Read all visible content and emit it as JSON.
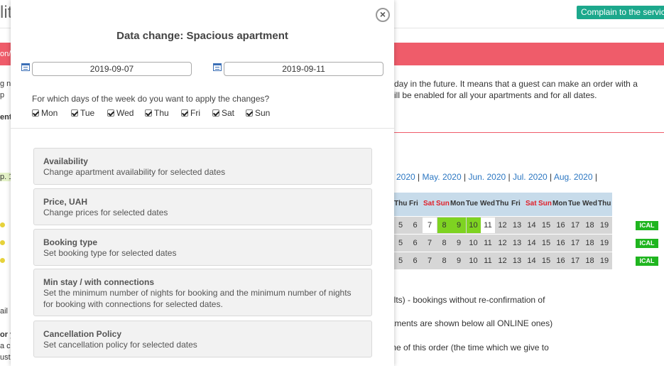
{
  "background": {
    "title_fragment": "lit",
    "complain_button": "Complain to the service",
    "alert_fragment": "on/",
    "info_line1": "day in the future. It means that a guest can make an order with a",
    "info_line2": "ill be enabled for all your apartments and for all dates.",
    "left_fragments": [
      "g n",
      "p",
      "ent",
      "p. 1",
      "ail",
      "or y",
      "a c",
      "ust"
    ],
    "months": [
      "r. 2020",
      "May. 2020",
      "Jun. 2020",
      "Jul. 2020",
      "Aug. 2020"
    ],
    "days": [
      "Thu",
      "Fri",
      "Sat",
      "Sun",
      "Mon",
      "Tue",
      "Wed",
      "Thu",
      "Fri",
      "Sat",
      "Sun",
      "Mon",
      "Tue",
      "Wed",
      "Thu"
    ],
    "row_numbers": [
      "5",
      "6",
      "7",
      "8",
      "9",
      "10",
      "11",
      "12",
      "13",
      "14",
      "15",
      "16",
      "17",
      "18",
      "19"
    ],
    "ical_label": "ICAL",
    "note1": "ults) - bookings without re-confirmation of",
    "note2": "rtments are shown below all ONLINE ones)",
    "note3": "me of this order (the time which we give to",
    "colors": {
      "accent_red": "#ef5c6a",
      "green": "#1ca88c",
      "calendar_header": "#c7dbea",
      "highlight_green": "#7ed321"
    }
  },
  "modal": {
    "title": "Data change: Spacious apartment",
    "close_icon": "close-icon",
    "date_from": "2019-09-07",
    "date_to": "2019-09-11",
    "question": "For which days of the week do you want to apply the changes?",
    "weekdays": [
      "Mon",
      "Tue",
      "Wed",
      "Thu",
      "Fri",
      "Sat",
      "Sun"
    ],
    "options": [
      {
        "title": "Availability",
        "desc": "Change apartment availability for selected dates"
      },
      {
        "title": "Price, UAH",
        "desc": "Change prices for selected dates"
      },
      {
        "title": "Booking type",
        "desc": "Set booking type for selected dates"
      },
      {
        "title": "Min stay / with connections",
        "desc": "Set the minimum number of nights for booking and the minimum number of nights for booking with connections for selected dates."
      },
      {
        "title": "Cancellation Policy",
        "desc": "Set cancellation policy for selected dates"
      }
    ]
  }
}
